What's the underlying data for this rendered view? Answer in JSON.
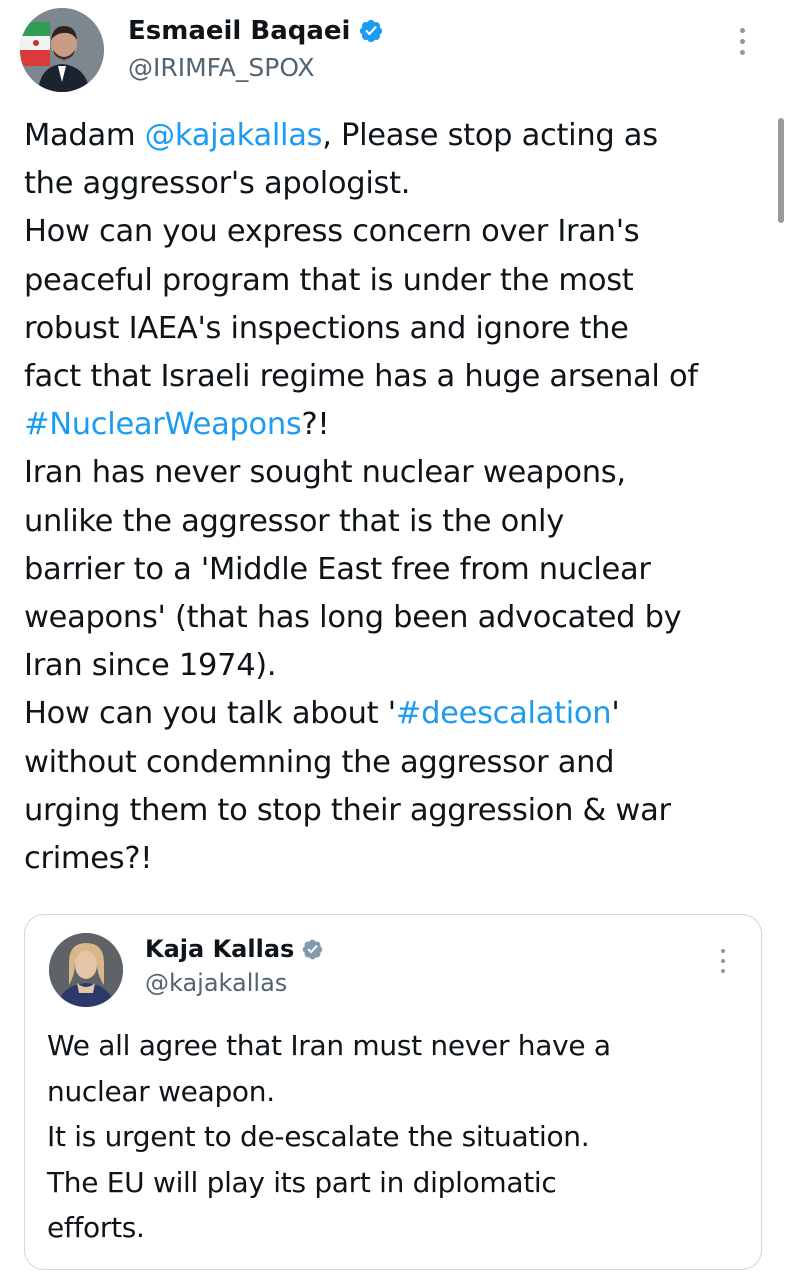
{
  "tweet": {
    "author": {
      "display_name": "Esmaeil Baqaei",
      "handle": "@IRIMFA_SPOX",
      "verified_icon": "verified-badge-icon"
    },
    "more_icon": "more-options-icon",
    "lines": [
      [
        {
          "t": "Madam ",
          "link": false
        },
        {
          "t": "@kajakallas",
          "link": true
        },
        {
          "t": ", Please stop acting as",
          "link": false
        }
      ],
      [
        {
          "t": "the aggressor's apologist.",
          "link": false
        }
      ],
      [
        {
          "t": "How can you express concern over Iran's",
          "link": false
        }
      ],
      [
        {
          "t": "peaceful program that is under the most",
          "link": false
        }
      ],
      [
        {
          "t": "robust IAEA's inspections and ignore the",
          "link": false
        }
      ],
      [
        {
          "t": "fact that Israeli regime has a huge arsenal of",
          "link": false
        }
      ],
      [
        {
          "t": "#NuclearWeapons",
          "link": true
        },
        {
          "t": "?!",
          "link": false
        }
      ],
      [
        {
          "t": "Iran has never sought nuclear weapons,",
          "link": false
        }
      ],
      [
        {
          "t": "unlike the aggressor that is the only",
          "link": false
        }
      ],
      [
        {
          "t": "barrier to a 'Middle East free from nuclear",
          "link": false
        }
      ],
      [
        {
          "t": "weapons' (that has long been advocated by",
          "link": false
        }
      ],
      [
        {
          "t": "Iran since 1974).",
          "link": false
        }
      ],
      [
        {
          "t": "How can you talk about  '",
          "link": false
        },
        {
          "t": "#deescalation",
          "link": true
        },
        {
          "t": "'",
          "link": false
        }
      ],
      [
        {
          "t": "without condemning the aggressor and",
          "link": false
        }
      ],
      [
        {
          "t": "urging them to stop their aggression & war",
          "link": false
        }
      ],
      [
        {
          "t": "crimes?!",
          "link": false
        }
      ]
    ]
  },
  "quoted_tweet": {
    "author": {
      "display_name": "Kaja Kallas",
      "handle": "@kajakallas",
      "verified_icon": "gray-verified-badge-icon"
    },
    "more_icon": "more-options-icon",
    "lines": [
      "We all agree that Iran must never have a",
      "nuclear weapon.",
      "It is urgent to de-escalate the situation.",
      "The EU will play its part in diplomatic",
      "efforts."
    ]
  },
  "colors": {
    "link": "#1d9bf0",
    "text": "#0f1419",
    "secondary": "#536471",
    "verified_blue": "#1d9bf0",
    "verified_gray": "#829aab",
    "border": "#cfd9de"
  }
}
